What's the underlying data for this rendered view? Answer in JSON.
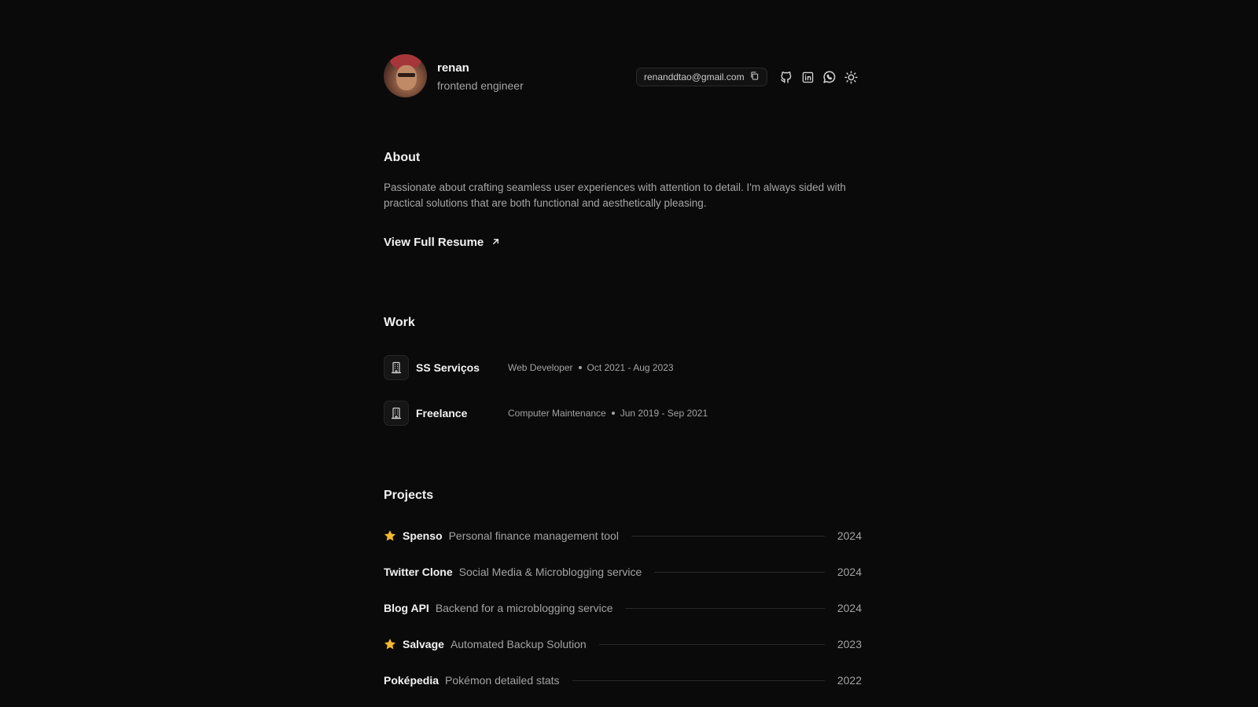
{
  "profile": {
    "name": "renan",
    "role": "frontend engineer",
    "email": "renanddtao@gmail.com"
  },
  "header_icons": [
    "copy-icon",
    "github-icon",
    "linkedin-icon",
    "whatsapp-icon",
    "sun-icon"
  ],
  "about": {
    "title": "About",
    "text": "Passionate about crafting seamless user experiences with attention to detail. I'm always sided with practical solutions that are both functional and aesthetically pleasing.",
    "resume_label": "View Full Resume"
  },
  "work": {
    "title": "Work",
    "items": [
      {
        "company": "SS Serviços",
        "position": "Web Developer",
        "period": "Oct 2021 - Aug 2023"
      },
      {
        "company": "Freelance",
        "position": "Computer Maintenance",
        "period": "Jun 2019 - Sep 2021"
      }
    ]
  },
  "projects": {
    "title": "Projects",
    "items": [
      {
        "name": "Spenso",
        "description": "Personal finance management tool",
        "year": "2024",
        "starred": true
      },
      {
        "name": "Twitter Clone",
        "description": "Social Media & Microblogging service",
        "year": "2024",
        "starred": false
      },
      {
        "name": "Blog API",
        "description": "Backend for a microblogging service",
        "year": "2024",
        "starred": false
      },
      {
        "name": "Salvage",
        "description": "Automated Backup Solution",
        "year": "2023",
        "starred": true
      },
      {
        "name": "Poképedia",
        "description": "Pokémon detailed stats",
        "year": "2022",
        "starred": false
      }
    ]
  },
  "colors": {
    "background": "#0a0a0a",
    "star": "#f5b82e",
    "text_primary": "#f2f2f2",
    "text_muted": "#a3a3a3"
  }
}
